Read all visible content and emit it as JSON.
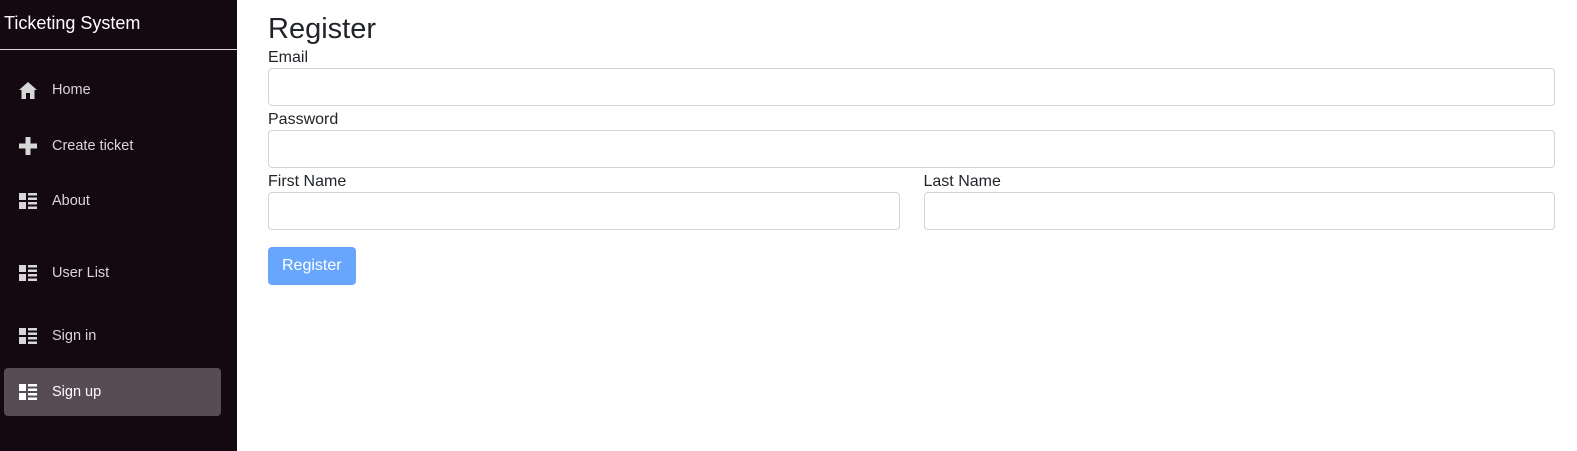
{
  "app": {
    "title": "Ticketing System"
  },
  "sidebar": {
    "items": [
      {
        "label": "Home",
        "icon": "home-icon",
        "active": false
      },
      {
        "label": "Create ticket",
        "icon": "plus-icon",
        "active": false
      },
      {
        "label": "About",
        "icon": "list-icon",
        "active": false
      },
      {
        "label": "User List",
        "icon": "list-icon",
        "active": false
      },
      {
        "label": "Sign in",
        "icon": "list-icon",
        "active": false
      },
      {
        "label": "Sign up",
        "icon": "list-icon",
        "active": true
      }
    ]
  },
  "form": {
    "title": "Register",
    "email_label": "Email",
    "email_value": "",
    "password_label": "Password",
    "password_value": "",
    "first_name_label": "First Name",
    "first_name_value": "",
    "last_name_label": "Last Name",
    "last_name_value": "",
    "submit_label": "Register"
  },
  "colors": {
    "sidebar_bg": "#140811",
    "active_item_bg": "#574c53",
    "button_bg": "#68a6fd"
  }
}
